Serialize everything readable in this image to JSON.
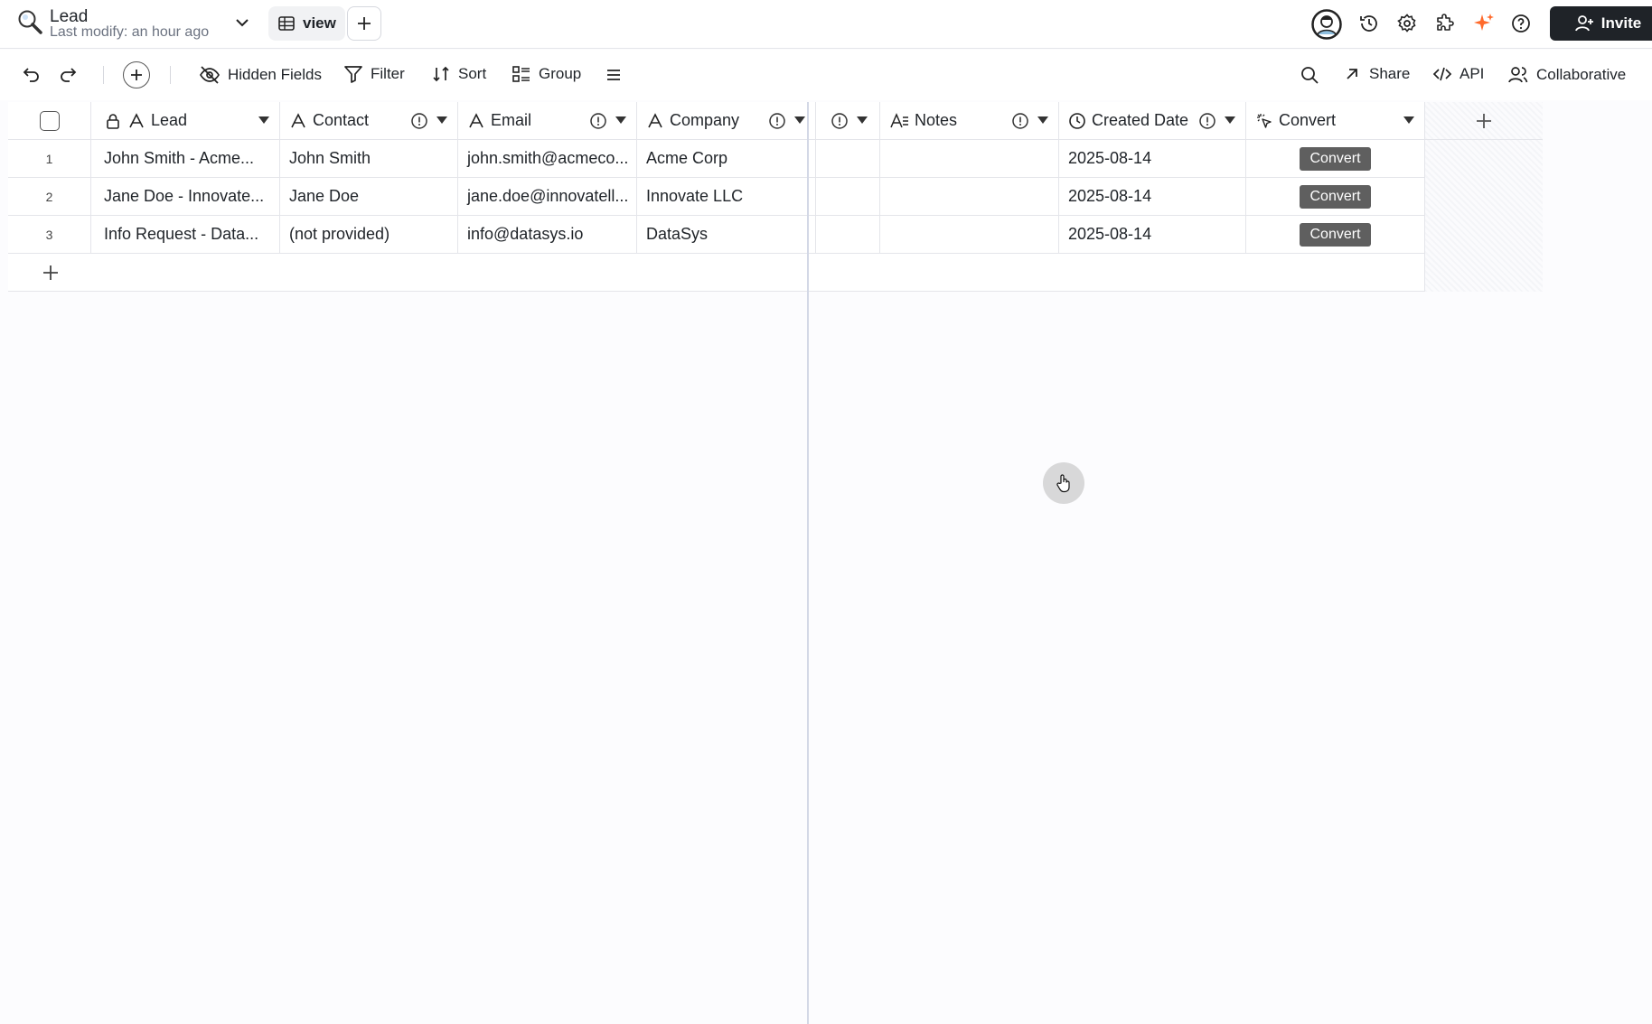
{
  "header": {
    "table_title": "Lead",
    "last_modified": "Last modify: an hour ago",
    "view_label": "view",
    "invite_label": "Invite",
    "accent_color": "#ff6a2b"
  },
  "toolbar": {
    "hidden_fields": "Hidden Fields",
    "filter": "Filter",
    "sort": "Sort",
    "group": "Group",
    "share": "Share",
    "api": "API",
    "collaborative": "Collaborative"
  },
  "columns": {
    "lead": "Lead",
    "contact": "Contact",
    "email": "Email",
    "company": "Company",
    "notes": "Notes",
    "created_date": "Created Date",
    "convert": "Convert"
  },
  "rows": [
    {
      "num": "1",
      "lead": "John Smith - Acme...",
      "contact": "John Smith",
      "email": "john.smith@acmeco...",
      "company": "Acme Corp",
      "created": "2025-08-14",
      "action": "Convert"
    },
    {
      "num": "2",
      "lead": "Jane Doe - Innovate...",
      "contact": "Jane Doe",
      "email": "jane.doe@innovatell...",
      "company": "Innovate LLC",
      "created": "2025-08-14",
      "action": "Convert"
    },
    {
      "num": "3",
      "lead": "Info Request - Data...",
      "contact": "(not provided)",
      "email": "info@datasys.io",
      "company": "DataSys",
      "created": "2025-08-14",
      "action": "Convert"
    }
  ],
  "icons": [
    "search-icon",
    "chevron-down-icon",
    "grid-icon",
    "plus-icon",
    "avatar",
    "history-icon",
    "gear-icon",
    "puzzle-icon",
    "sparkle-icon",
    "help-icon",
    "user-plus-icon",
    "undo-icon",
    "redo-icon",
    "eye-off-icon",
    "filter-icon",
    "sort-icon",
    "group-icon",
    "menu-icon",
    "share-arrow-icon",
    "code-icon",
    "users-icon",
    "lock-icon",
    "text-field-icon",
    "info-icon",
    "dropdown-arrow-icon",
    "long-text-icon",
    "clock-icon",
    "button-field-icon"
  ]
}
